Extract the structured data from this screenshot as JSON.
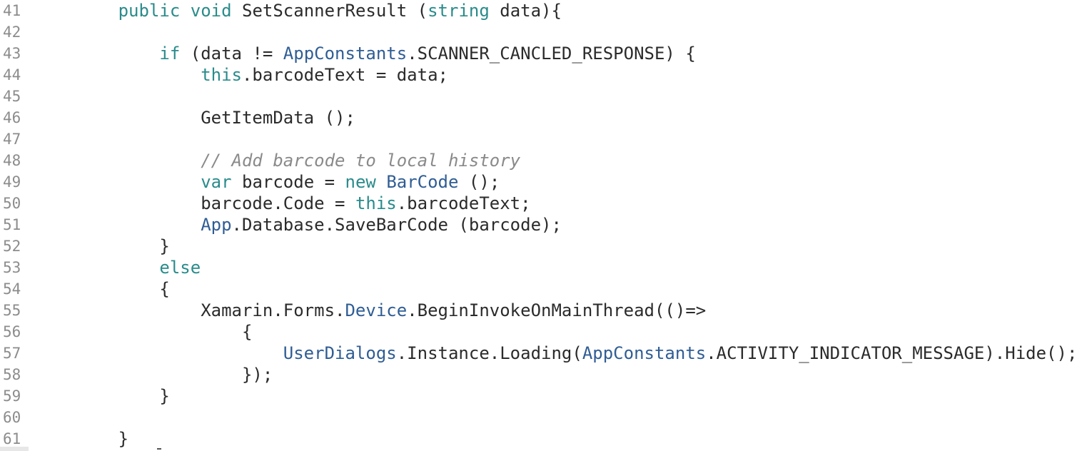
{
  "editor": {
    "lines": [
      {
        "num": "41",
        "tokens": [
          {
            "t": "        ",
            "k": "txt"
          },
          {
            "t": "public",
            "k": "kw"
          },
          {
            "t": " ",
            "k": "txt"
          },
          {
            "t": "void",
            "k": "kw"
          },
          {
            "t": " SetScannerResult (",
            "k": "txt"
          },
          {
            "t": "string",
            "k": "kw"
          },
          {
            "t": " data){",
            "k": "txt"
          }
        ]
      },
      {
        "num": "42",
        "tokens": []
      },
      {
        "num": "43",
        "tokens": [
          {
            "t": "            ",
            "k": "txt"
          },
          {
            "t": "if",
            "k": "kw"
          },
          {
            "t": " (data != ",
            "k": "txt"
          },
          {
            "t": "AppConstants",
            "k": "type"
          },
          {
            "t": ".SCANNER_CANCLED_RESPONSE) {",
            "k": "txt"
          }
        ]
      },
      {
        "num": "44",
        "tokens": [
          {
            "t": "                ",
            "k": "txt"
          },
          {
            "t": "this",
            "k": "kw"
          },
          {
            "t": ".barcodeText = data;",
            "k": "txt"
          }
        ]
      },
      {
        "num": "45",
        "tokens": []
      },
      {
        "num": "46",
        "tokens": [
          {
            "t": "                GetItemData ();",
            "k": "txt"
          }
        ]
      },
      {
        "num": "47",
        "tokens": []
      },
      {
        "num": "48",
        "tokens": [
          {
            "t": "                ",
            "k": "txt"
          },
          {
            "t": "// Add barcode to local history",
            "k": "cmt"
          }
        ]
      },
      {
        "num": "49",
        "tokens": [
          {
            "t": "                ",
            "k": "txt"
          },
          {
            "t": "var",
            "k": "kw"
          },
          {
            "t": " barcode = ",
            "k": "txt"
          },
          {
            "t": "new",
            "k": "kw"
          },
          {
            "t": " ",
            "k": "txt"
          },
          {
            "t": "BarCode",
            "k": "type"
          },
          {
            "t": " ();",
            "k": "txt"
          }
        ]
      },
      {
        "num": "50",
        "tokens": [
          {
            "t": "                barcode.Code = ",
            "k": "txt"
          },
          {
            "t": "this",
            "k": "kw"
          },
          {
            "t": ".barcodeText;",
            "k": "txt"
          }
        ]
      },
      {
        "num": "51",
        "tokens": [
          {
            "t": "                ",
            "k": "txt"
          },
          {
            "t": "App",
            "k": "type"
          },
          {
            "t": ".Database.SaveBarCode (barcode);",
            "k": "txt"
          }
        ]
      },
      {
        "num": "52",
        "tokens": [
          {
            "t": "            }",
            "k": "txt"
          }
        ]
      },
      {
        "num": "53",
        "tokens": [
          {
            "t": "            ",
            "k": "txt"
          },
          {
            "t": "else",
            "k": "kw"
          }
        ]
      },
      {
        "num": "54",
        "tokens": [
          {
            "t": "            {",
            "k": "txt"
          }
        ]
      },
      {
        "num": "55",
        "tokens": [
          {
            "t": "                Xamarin.Forms.",
            "k": "txt"
          },
          {
            "t": "Device",
            "k": "type"
          },
          {
            "t": ".BeginInvokeOnMainThread(()=>",
            "k": "txt"
          }
        ]
      },
      {
        "num": "56",
        "tokens": [
          {
            "t": "                    {",
            "k": "txt"
          }
        ]
      },
      {
        "num": "57",
        "tokens": [
          {
            "t": "                        ",
            "k": "txt"
          },
          {
            "t": "UserDialogs",
            "k": "type"
          },
          {
            "t": ".Instance.Loading(",
            "k": "txt"
          },
          {
            "t": "AppConstants",
            "k": "type"
          },
          {
            "t": ".ACTIVITY_INDICATOR_MESSAGE).Hide();",
            "k": "txt"
          }
        ]
      },
      {
        "num": "58",
        "tokens": [
          {
            "t": "                    });",
            "k": "txt"
          }
        ]
      },
      {
        "num": "59",
        "tokens": [
          {
            "t": "            }",
            "k": "txt"
          }
        ]
      },
      {
        "num": "60",
        "tokens": []
      },
      {
        "num": "61",
        "tokens": [
          {
            "t": "        }",
            "k": "txt"
          }
        ]
      }
    ]
  },
  "colors": {
    "keyword": "#2a8b8b",
    "type": "#2f5d94",
    "comment": "#8a8a8a",
    "text": "#2b2b2b",
    "line_number": "#8c8c8c",
    "background": "#ffffff"
  }
}
